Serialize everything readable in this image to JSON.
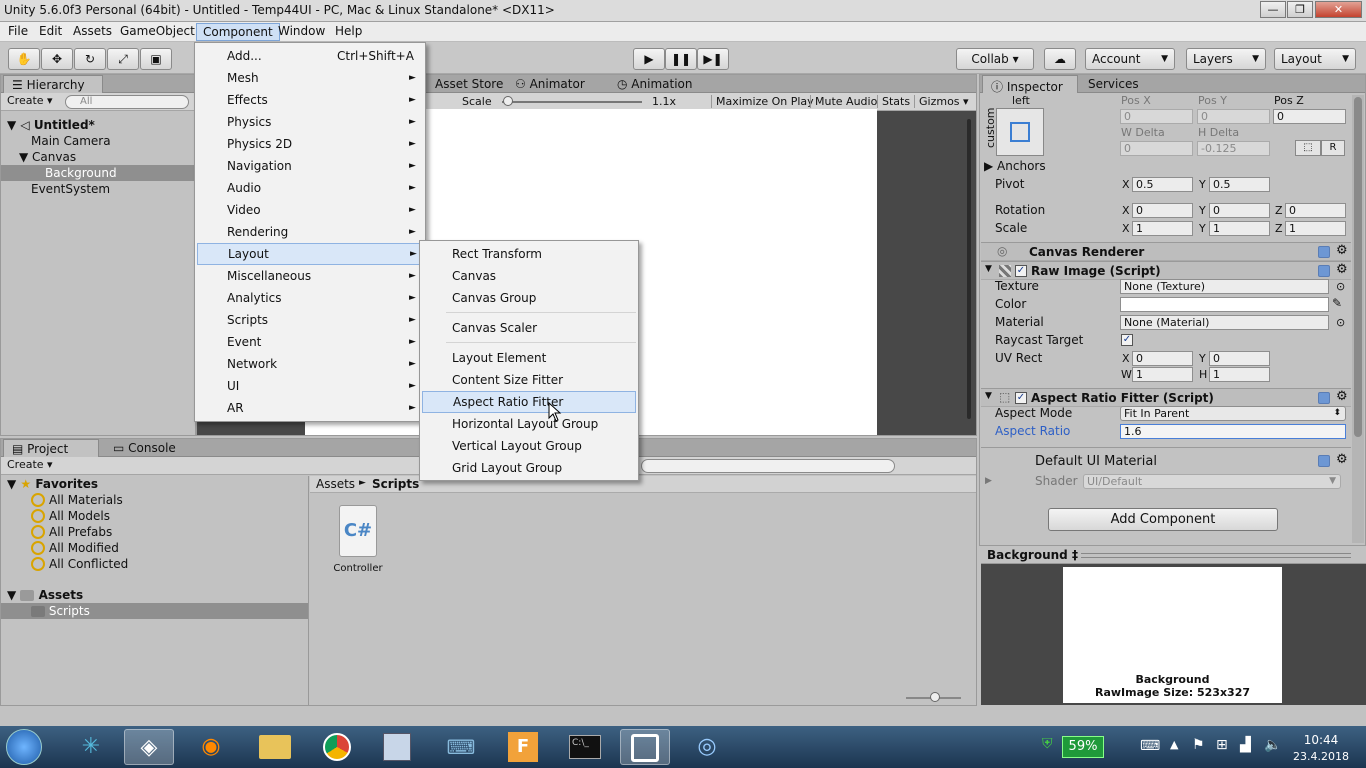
{
  "window": {
    "title": "Unity 5.6.0f3 Personal (64bit) - Untitled - Temp44UI - PC, Mac & Linux Standalone* <DX11>",
    "min": "—",
    "max": "❐",
    "close": "✕"
  },
  "menubar": [
    "File",
    "Edit",
    "Assets",
    "GameObject",
    "Component",
    "Window",
    "Help"
  ],
  "toolbar": {
    "collab": "Collab ▾",
    "account": "Account",
    "layers": "Layers",
    "layout": "Layout"
  },
  "hierarchy": {
    "tab": "Hierarchy",
    "create": "Create ▾",
    "search_placeholder": "All",
    "scene": "Untitled*",
    "items": [
      "Main Camera",
      "Canvas",
      "Background",
      "EventSystem"
    ]
  },
  "scene_tabs": {
    "asset_store": "Asset Store",
    "animator": "Animator",
    "animation": "Animation"
  },
  "game_bar": {
    "scale_label": "Scale",
    "scale_value": "1.1x",
    "maximize": "Maximize On Play",
    "mute": "Mute Audio",
    "stats": "Stats",
    "gizmos": "Gizmos ▾"
  },
  "component_menu": [
    {
      "label": "Add...",
      "shortcut": "Ctrl+Shift+A",
      "arrow": false
    },
    {
      "label": "Mesh",
      "arrow": true
    },
    {
      "label": "Effects",
      "arrow": true
    },
    {
      "label": "Physics",
      "arrow": true
    },
    {
      "label": "Physics 2D",
      "arrow": true
    },
    {
      "label": "Navigation",
      "arrow": true
    },
    {
      "label": "Audio",
      "arrow": true
    },
    {
      "label": "Video",
      "arrow": true
    },
    {
      "label": "Rendering",
      "arrow": true
    },
    {
      "label": "Layout",
      "arrow": true
    },
    {
      "label": "Miscellaneous",
      "arrow": true
    },
    {
      "label": "Analytics",
      "arrow": true
    },
    {
      "label": "Scripts",
      "arrow": true
    },
    {
      "label": "Event",
      "arrow": true
    },
    {
      "label": "Network",
      "arrow": true
    },
    {
      "label": "UI",
      "arrow": true
    },
    {
      "label": "AR",
      "arrow": true
    }
  ],
  "layout_submenu": {
    "rect_transform": "Rect Transform",
    "canvas": "Canvas",
    "canvas_group": "Canvas Group",
    "canvas_scaler": "Canvas Scaler",
    "layout_element": "Layout Element",
    "content_size_fitter": "Content Size Fitter",
    "aspect_ratio_fitter": "Aspect Ratio Fitter",
    "horizontal_layout_group": "Horizontal Layout Group",
    "vertical_layout_group": "Vertical Layout Group",
    "grid_layout_group": "Grid Layout Group"
  },
  "project": {
    "tab": "Project",
    "console_tab": "Console",
    "create": "Create ▾",
    "favorites_label": "Favorites",
    "favorites": [
      "All Materials",
      "All Models",
      "All Prefabs",
      "All Modified",
      "All Conflicted"
    ],
    "assets_label": "Assets",
    "scripts_folder": "Scripts",
    "breadcrumb_root": "Assets",
    "breadcrumb_sep": "►",
    "breadcrumb_current": "Scripts",
    "file_name": "Controller",
    "file_glyph": "C#"
  },
  "inspector": {
    "tab": "Inspector",
    "services_tab": "Services",
    "anchor_preset_top": "left",
    "anchor_preset_side": "custom",
    "pos_x_label": "Pos X",
    "pos_y_label": "Pos Y",
    "pos_z_label": "Pos Z",
    "pos_x": "0",
    "pos_y": "0",
    "pos_z": "0",
    "w_delta_label": "W Delta",
    "h_delta_label": "H Delta",
    "w_delta": "0",
    "h_delta": "-0.125",
    "r_button": "R",
    "anchors": "Anchors",
    "pivot": "Pivot",
    "pivot_x": "0.5",
    "pivot_y": "0.5",
    "rotation": "Rotation",
    "rot_x": "0",
    "rot_y": "0",
    "rot_z": "0",
    "scale": "Scale",
    "scale_x": "1",
    "scale_y": "1",
    "scale_z": "1",
    "axis_x": "X",
    "axis_y": "Y",
    "axis_z": "Z",
    "axis_w": "W",
    "axis_h": "H",
    "canvas_renderer": "Canvas Renderer",
    "raw_image": "Raw Image (Script)",
    "texture_label": "Texture",
    "texture": "None (Texture)",
    "color_label": "Color",
    "material_label": "Material",
    "material": "None (Material)",
    "raycast_label": "Raycast Target",
    "uvrect_label": "UV Rect",
    "uv_x": "0",
    "uv_y": "0",
    "uv_w": "1",
    "uv_h": "1",
    "arf": "Aspect Ratio Fitter (Script)",
    "aspect_mode_label": "Aspect Mode",
    "aspect_mode": "Fit In Parent",
    "aspect_ratio_label": "Aspect Ratio",
    "aspect_ratio": "1.6",
    "default_material": "Default UI Material",
    "shader_label": "Shader",
    "shader": "UI/Default",
    "add_component": "Add Component",
    "preview_title": "Background ‡",
    "preview_caption1": "Background",
    "preview_caption2": "RawImage Size: 523x327"
  },
  "taskbar": {
    "battery": "59%",
    "time": "10:44",
    "date": "23.4.2018"
  }
}
